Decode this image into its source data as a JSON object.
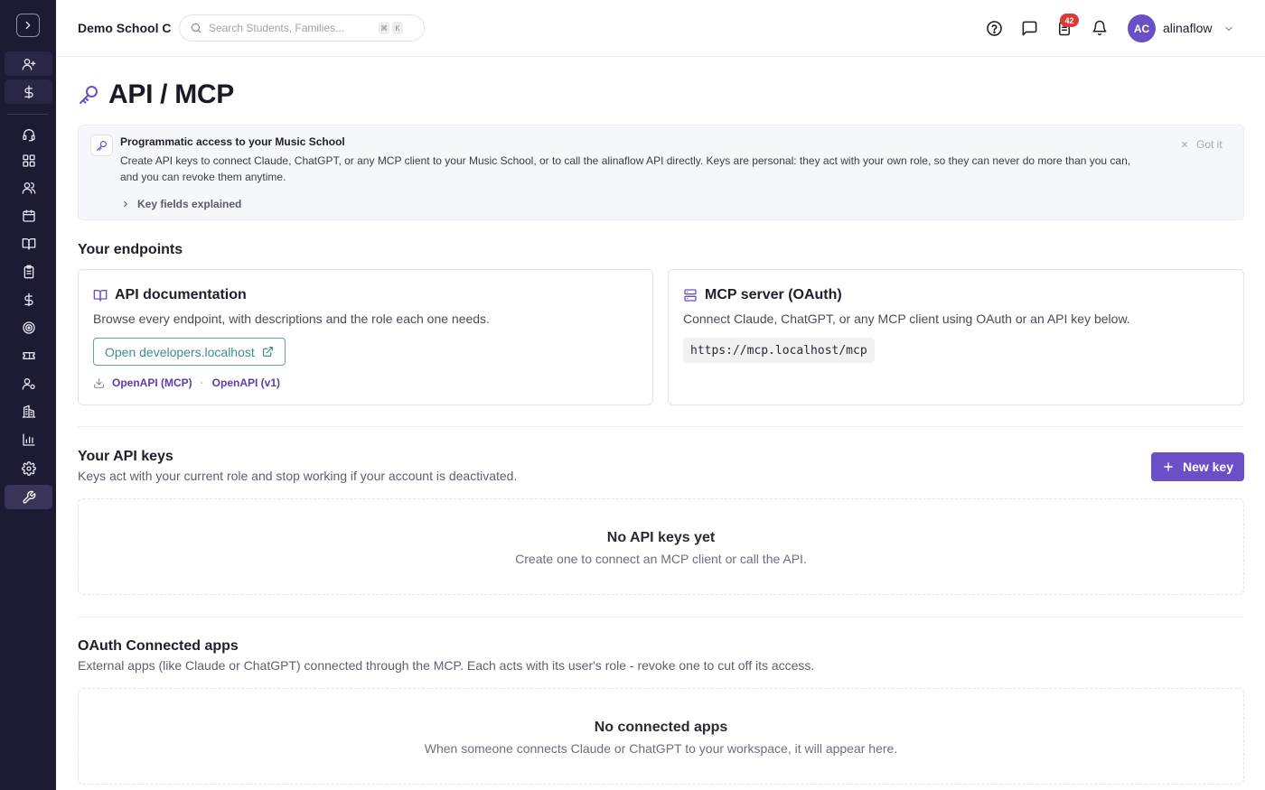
{
  "colors": {
    "sidebar_bg": "#1d1a33",
    "accent_purple": "#6a4fc7",
    "accent_teal": "#3e8f86",
    "badge_red": "#dc3a3a"
  },
  "sidebar": {
    "toggle_icon": "chevron-right-icon",
    "items": [
      {
        "icon": "user-plus-icon"
      },
      {
        "icon": "dollar-icon"
      },
      {
        "icon": "headset-icon"
      },
      {
        "icon": "dashboard-grid-icon"
      },
      {
        "icon": "users-icon"
      },
      {
        "icon": "calendar-icon"
      },
      {
        "icon": "book-open-icon"
      },
      {
        "icon": "clipboard-icon"
      },
      {
        "icon": "dollar-icon"
      },
      {
        "icon": "target-icon"
      },
      {
        "icon": "ticket-icon"
      },
      {
        "icon": "user-settings-icon"
      },
      {
        "icon": "building-icon"
      },
      {
        "icon": "bar-chart-icon"
      },
      {
        "icon": "gear-icon"
      },
      {
        "icon": "wrench-icon",
        "active": true
      }
    ]
  },
  "topbar": {
    "school_name": "Demo School C",
    "search_placeholder": "Search Students, Families...",
    "search_kbd_1": "⌘",
    "search_kbd_2": "K",
    "tasks_badge": "42",
    "avatar_initials": "AC",
    "username": "alinaflow"
  },
  "page": {
    "title": "API / MCP"
  },
  "banner": {
    "title": "Programmatic access to your Music School",
    "description": "Create API keys to connect Claude, ChatGPT, or any MCP client to your Music School, or to call the alinaflow API directly. Keys are personal: they act with your own role, so they can never do more than you can, and you can revoke them anytime.",
    "toggle_label": "Key fields explained",
    "dismiss_label": "Got it"
  },
  "endpoints": {
    "section_title": "Your endpoints",
    "api_card": {
      "title": "API documentation",
      "description": "Browse every endpoint, with descriptions and the role each one needs.",
      "button_label": "Open developers.localhost",
      "link_mcp": "OpenAPI (MCP)",
      "link_v1": "OpenAPI (v1)",
      "separator": "·"
    },
    "mcp_card": {
      "title": "MCP server (OAuth)",
      "description": "Connect Claude, ChatGPT, or any MCP client using OAuth or an API key below.",
      "url": "https://mcp.localhost/mcp"
    }
  },
  "api_keys": {
    "section_title": "Your API keys",
    "section_sub": "Keys act with your current role and stop working if your account is deactivated.",
    "new_key_label": "New key",
    "empty_title": "No API keys yet",
    "empty_sub": "Create one to connect an MCP client or call the API."
  },
  "oauth_apps": {
    "section_title": "OAuth Connected apps",
    "section_sub": "External apps (like Claude or ChatGPT) connected through the MCP. Each acts with its user's role - revoke one to cut off its access.",
    "empty_title": "No connected apps",
    "empty_sub": "When someone connects Claude or ChatGPT to your workspace, it will appear here."
  }
}
